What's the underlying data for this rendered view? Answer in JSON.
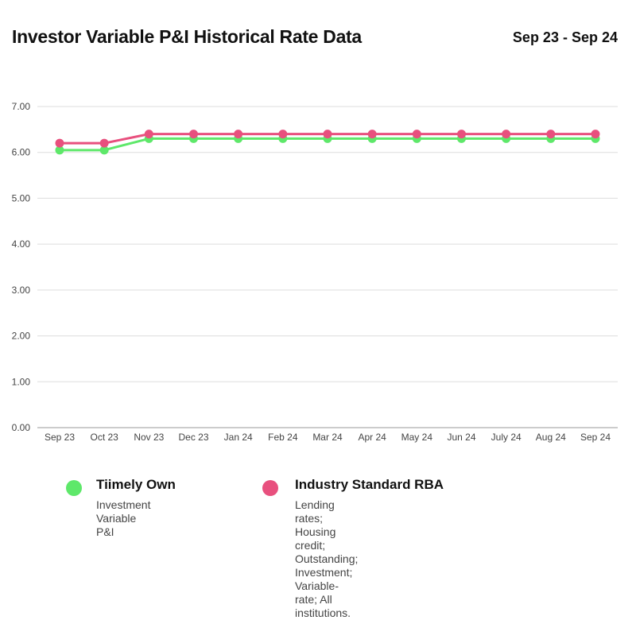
{
  "header": {
    "title": "Investor Variable P&I Historical Rate Data",
    "date_range": "Sep 23 - Sep 24"
  },
  "colors": {
    "tiimely": "#5ee86a",
    "rba": "#e8507e",
    "grid": "#dddddd",
    "axis": "#999999"
  },
  "chart_data": {
    "type": "line",
    "title": "Investor Variable P&I Historical Rate Data",
    "subtitle": "Sep 23 - Sep 24",
    "xlabel": "",
    "ylabel": "",
    "categories": [
      "Sep 23",
      "Oct 23",
      "Nov 23",
      "Dec 23",
      "Jan 24",
      "Feb 24",
      "Mar 24",
      "Apr 24",
      "May 24",
      "Jun 24",
      "July 24",
      "Aug 24",
      "Sep 24"
    ],
    "ylim": [
      0,
      7
    ],
    "yticks": [
      "0.00",
      "1.00",
      "2.00",
      "3.00",
      "4.00",
      "5.00",
      "6.00",
      "7.00"
    ],
    "grid": true,
    "legend_position": "bottom",
    "series": [
      {
        "name": "Tiimely Own",
        "description": "Investment\nVariable P&I",
        "color": "#5ee86a",
        "values": [
          6.05,
          6.05,
          6.3,
          6.3,
          6.3,
          6.3,
          6.3,
          6.3,
          6.3,
          6.3,
          6.3,
          6.3,
          6.3
        ]
      },
      {
        "name": "Industry Standard RBA",
        "description": "Lending rates; Housing credit; Outstanding;\nInvestment; Variable-rate; All institutions.",
        "color": "#e8507e",
        "values": [
          6.2,
          6.2,
          6.4,
          6.4,
          6.4,
          6.4,
          6.4,
          6.4,
          6.4,
          6.4,
          6.4,
          6.4,
          6.4
        ]
      }
    ]
  }
}
